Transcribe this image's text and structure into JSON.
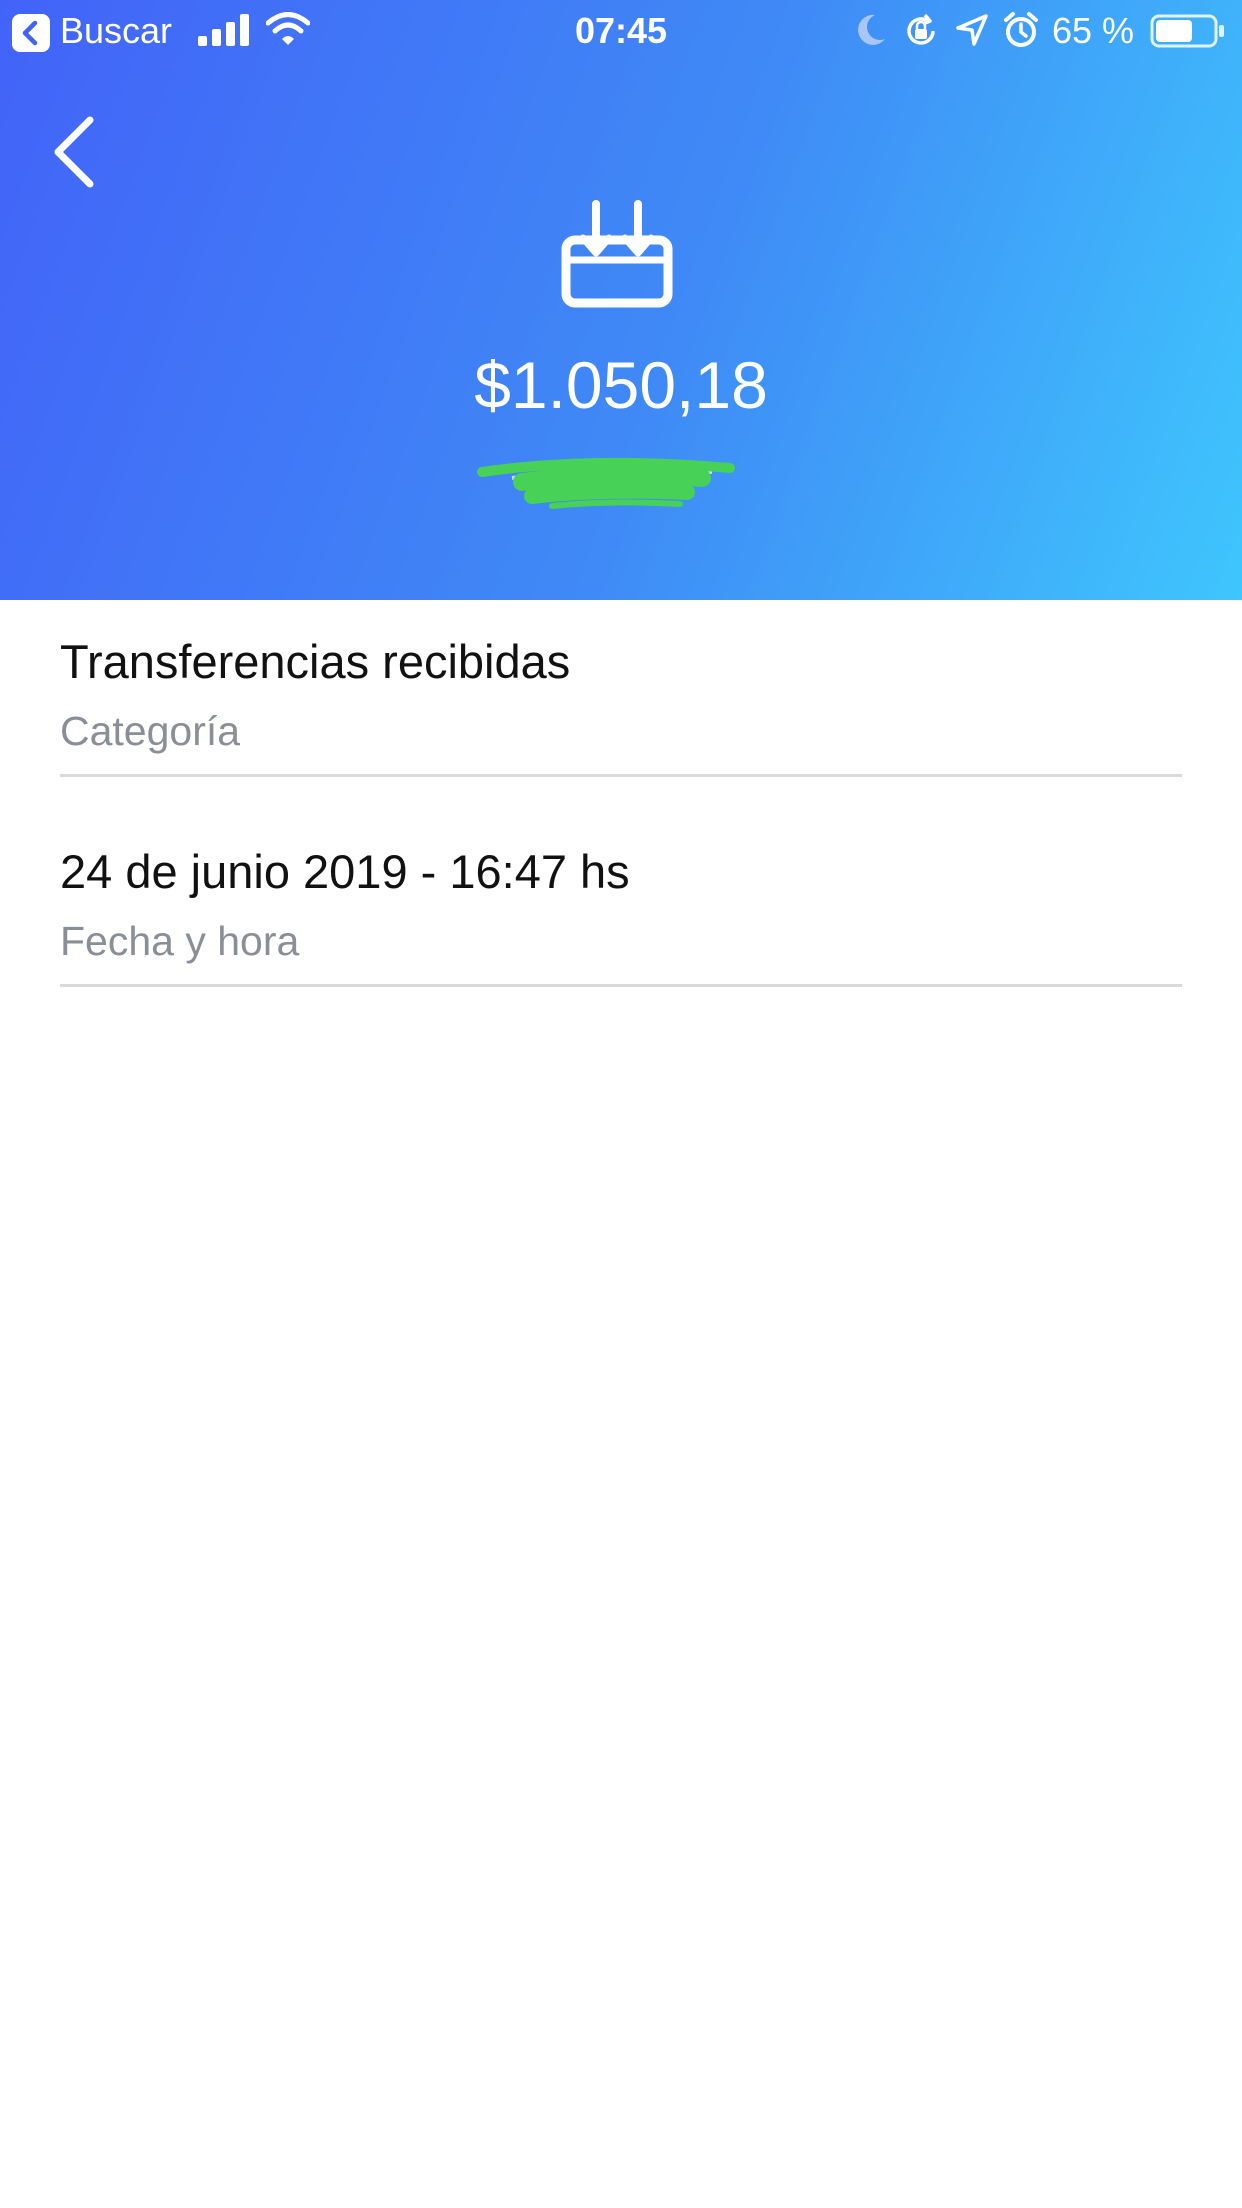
{
  "status_bar": {
    "back_label": "Buscar",
    "time": "07:45",
    "battery_percent": "65 %",
    "battery_level": 0.65
  },
  "header": {
    "amount": "$1.050,18",
    "gradient_colors": [
      "#4263f8",
      "#3f8af6",
      "#3fc6fd"
    ],
    "icon": "incoming-box-icon"
  },
  "details": [
    {
      "value": "Transferencias recibidas",
      "label": "Categoría"
    },
    {
      "value": "24 de junio 2019 - 16:47 hs",
      "label": "Fecha y hora"
    }
  ]
}
